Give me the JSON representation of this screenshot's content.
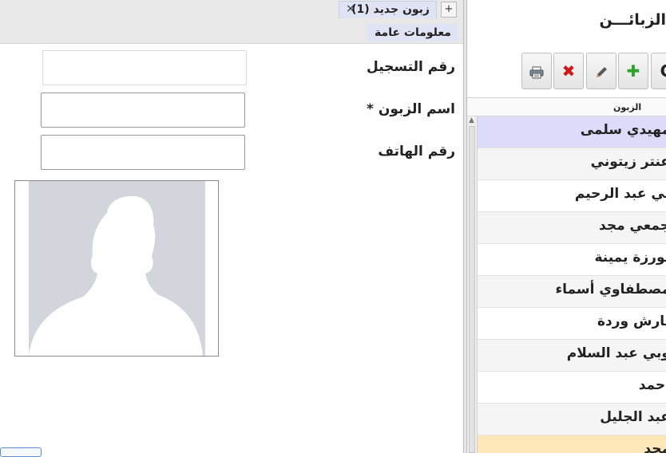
{
  "tabs": {
    "add_label": "+",
    "doc_tab_label": "زبون جديد (1)",
    "close_glyph": "×",
    "subtab_label": "معلومات عامة"
  },
  "form": {
    "registration_label": "رقم التسجيل",
    "registration_value": "",
    "name_label": "اسم الزبون *",
    "name_value": "",
    "phone_label": "رقم الهاتف",
    "phone_value": ""
  },
  "right": {
    "title": "الزبائـــن",
    "toolbar": {
      "print_icon": "printer-icon",
      "delete_icon": "red-x-icon",
      "edit_icon": "pencil-icon",
      "add_icon": "green-plus-icon",
      "refresh_icon": "refresh-icon",
      "delete_glyph": "✖",
      "add_glyph": "✚",
      "refresh_glyph": "C"
    },
    "list_header": "الزبون",
    "customers": [
      "مهيدي سلمى",
      "عنتر زيتوني",
      "ني عبد الرحيم",
      "جمعي مجد",
      "بورزة يمينة",
      "مصطفاوي أسماء",
      "بارش وردة",
      "وبي عبد السلام",
      "أحمد",
      "عبد الجليل",
      "مجد"
    ]
  },
  "colors": {
    "selected_row": "#dcdcfa",
    "highlight_row": "#fde7b8",
    "tab_bg": "#dfe3f4",
    "photo_placeholder": "#d2d6dc"
  }
}
